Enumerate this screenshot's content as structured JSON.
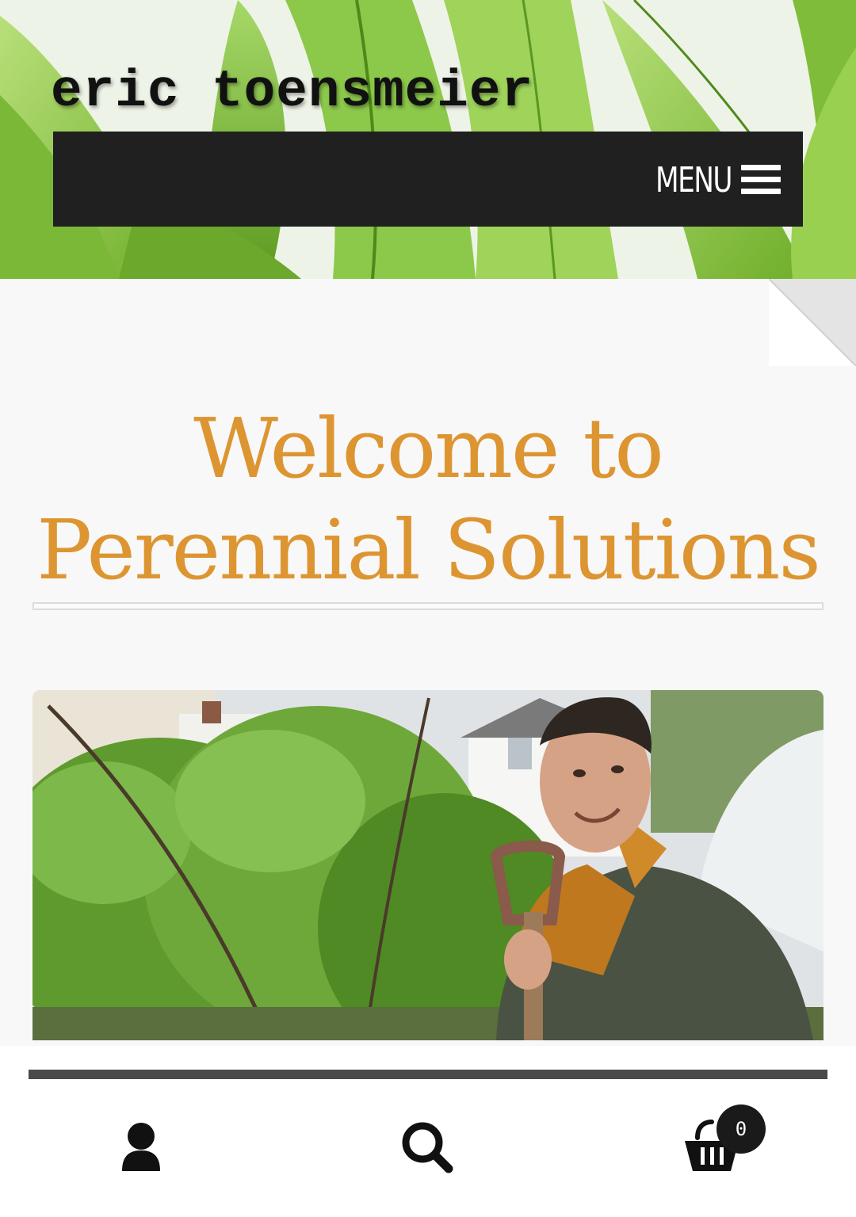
{
  "header": {
    "site_title": "eric toensmeier",
    "menu_label": "MENU"
  },
  "main": {
    "title_line1": "Welcome to",
    "title_line2": "Perennial Solutions"
  },
  "toolbar": {
    "cart_count": "0"
  },
  "icons": [
    "hamburger-icon",
    "user-icon",
    "search-icon",
    "cart-icon"
  ],
  "colors": {
    "accent": "#dd9532",
    "navbar": "#202020"
  }
}
